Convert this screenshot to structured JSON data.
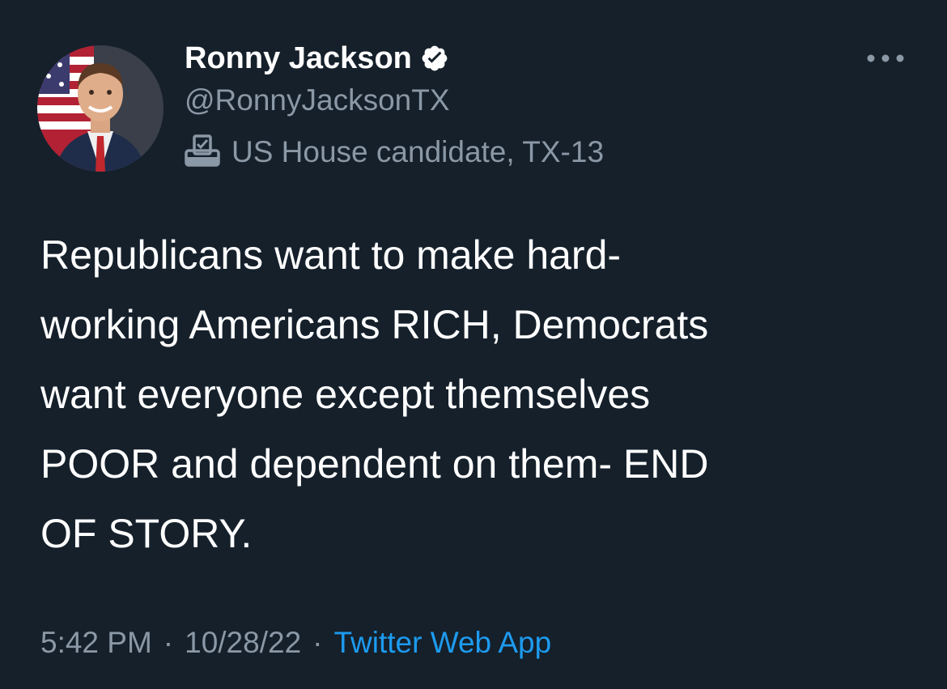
{
  "author": {
    "display_name": "Ronny Jackson",
    "handle": "@RonnyJacksonTX",
    "verified": true,
    "label": "US House candidate, TX-13",
    "label_icon": "ballot-box-icon"
  },
  "tweet": {
    "text_lines": [
      "Republicans want to make hard-",
      "working Americans RICH, Democrats",
      "want everyone except themselves",
      "POOR and dependent on them- END",
      "OF STORY."
    ]
  },
  "meta": {
    "time": "5:42 PM",
    "separator": "·",
    "date": "10/28/22",
    "source": "Twitter Web App"
  },
  "colors": {
    "background": "#15202b",
    "text_primary": "#ffffff",
    "text_secondary": "#8b98a5",
    "link": "#1d9bf0"
  },
  "icons": {
    "more": "more-horizontal-icon",
    "verified": "verified-badge-icon"
  }
}
